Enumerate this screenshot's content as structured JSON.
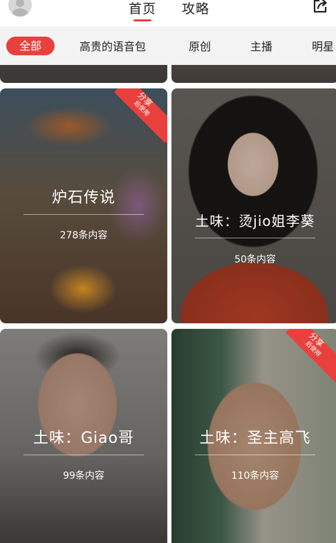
{
  "header": {
    "tabs": [
      {
        "label": "首页",
        "active": true
      },
      {
        "label": "攻略",
        "active": false
      }
    ],
    "share_icon": "share-icon",
    "avatar_icon": "avatar-icon"
  },
  "categories": [
    {
      "label": "全部",
      "active": true
    },
    {
      "label": "高贵的语音包",
      "active": false
    },
    {
      "label": "原创",
      "active": false
    },
    {
      "label": "主播",
      "active": false
    },
    {
      "label": "明星",
      "active": false
    }
  ],
  "cards": [
    {
      "title": "炉石传说",
      "count": "278条内容",
      "ribbon": {
        "line1": "分享",
        "line2": "后使用"
      }
    },
    {
      "title": "土味：烫jio姐李葵",
      "count": "50条内容"
    },
    {
      "title": "土味：Giao哥",
      "count": "99条内容"
    },
    {
      "title": "土味：圣主高飞",
      "count": "110条内容",
      "ribbon": {
        "line1": "分享",
        "line2": "后使用"
      }
    }
  ],
  "colors": {
    "accent": "#e8413d",
    "category_bar_bg": "#f3f3f3",
    "text_primary": "#222222"
  }
}
